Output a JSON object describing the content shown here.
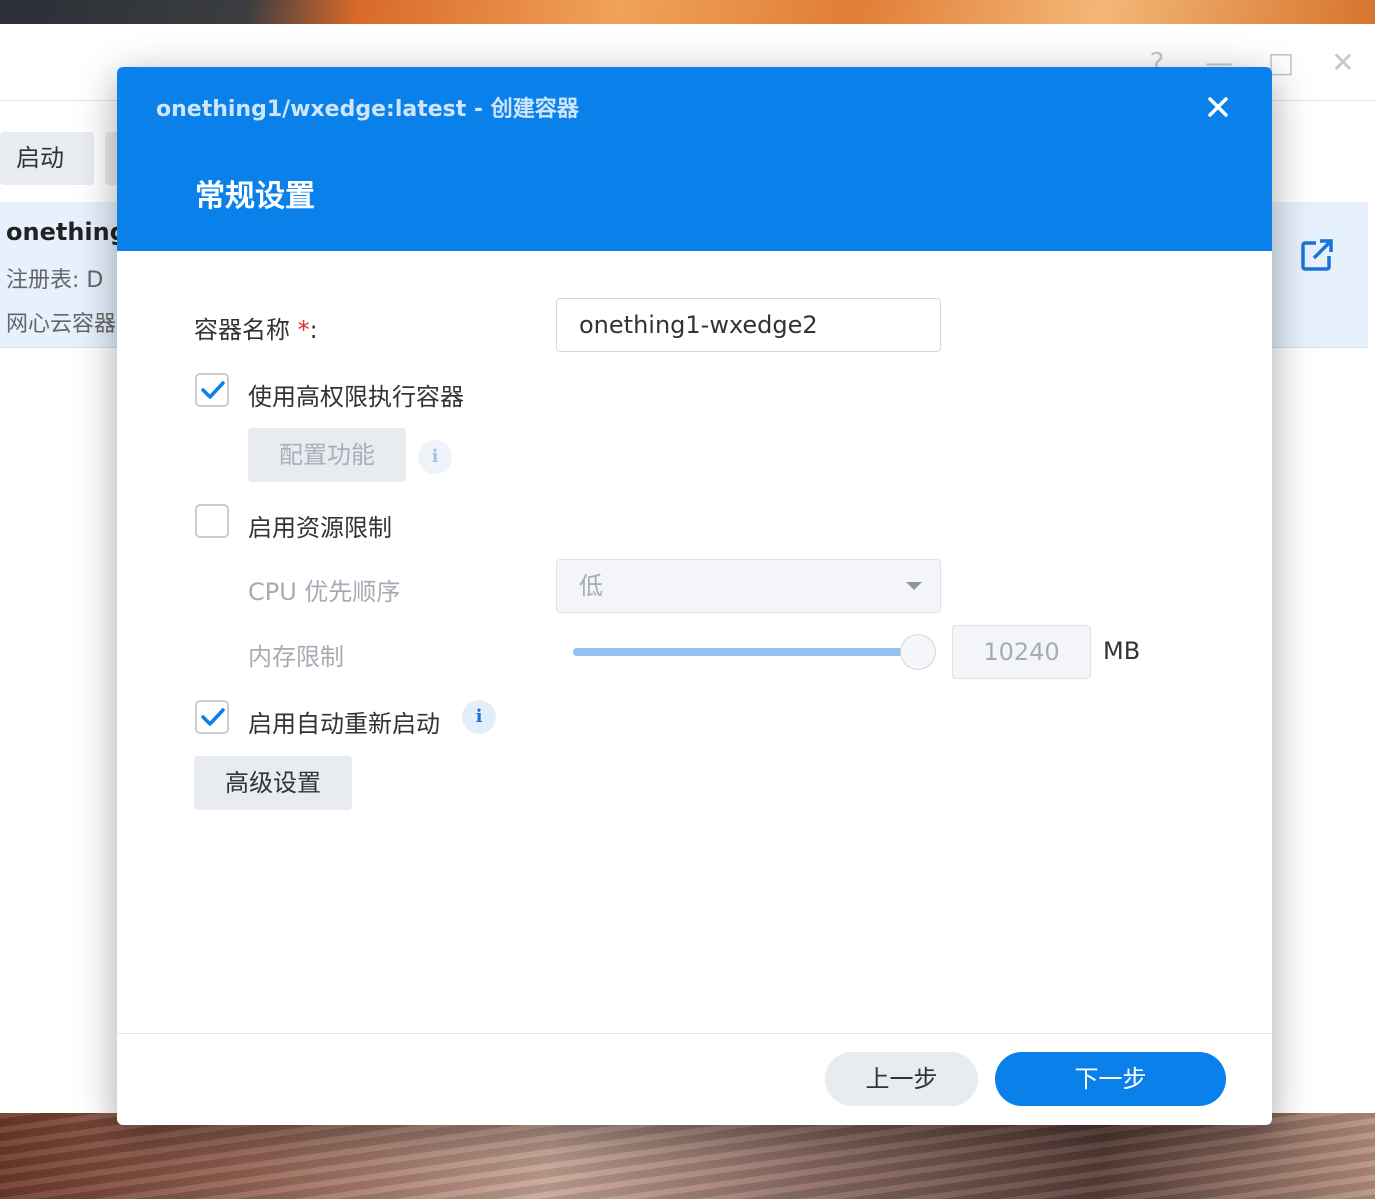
{
  "background_app": {
    "window_controls": {
      "help": "?",
      "minimize": "—",
      "maximize": "□",
      "close": "✕"
    },
    "toolbar": {
      "start_label": "启动"
    },
    "row": {
      "title": "onething",
      "registry": "注册表: D",
      "description": "网心云容器"
    }
  },
  "dialog": {
    "title": "onething1/wxedge:latest - 创建容器",
    "section": "常规设置",
    "container_name": {
      "label": "容器名称",
      "required_mark": "*",
      "colon": ":",
      "value": "onething1-wxedge2"
    },
    "privileged": {
      "label": "使用高权限执行容器",
      "checked": true,
      "configure_button": "配置功能"
    },
    "resource_limit": {
      "label": "启用资源限制",
      "checked": false,
      "cpu_priority": {
        "label": "CPU 优先顺序",
        "value": "低"
      },
      "memory_limit": {
        "label": "内存限制",
        "value": "10240",
        "unit": "MB",
        "slider_fraction": 1.0
      }
    },
    "auto_restart": {
      "label": "启用自动重新启动",
      "checked": true
    },
    "advanced_button": "高级设置",
    "footer": {
      "prev": "上一步",
      "next": "下一步"
    }
  },
  "colors": {
    "accent": "#0a80eb",
    "check": "#0a80eb"
  }
}
